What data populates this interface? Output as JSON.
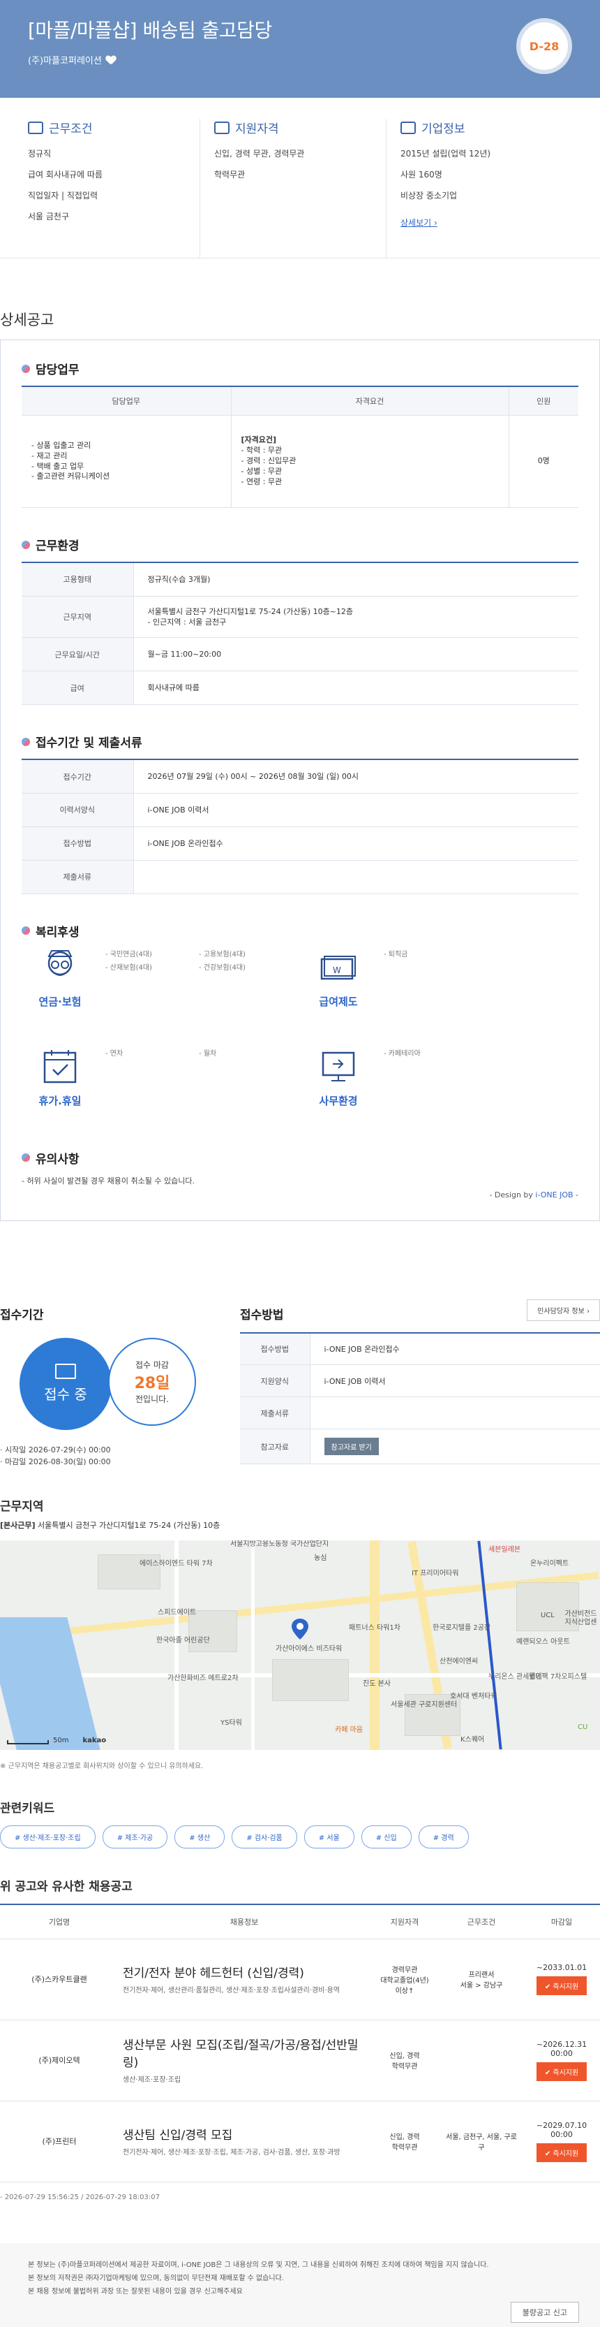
{
  "header": {
    "title": "[마플/마플샵] 배송팀 출고담당",
    "company": "(주)마플코퍼레이션",
    "dday": "D-28"
  },
  "summary": {
    "work_title": "근무조건",
    "work_lines": [
      "정규직",
      "급여 회사내규에 따름",
      "직업일자 | 직접입력",
      "서울 금천구"
    ],
    "qual_title": "지원자격",
    "qual_lines": [
      "신입, 경력 무관, 경력무관",
      "학력무관"
    ],
    "corp_title": "기업정보",
    "corp_lines": [
      "2015년 설립(업력 12년)",
      "사원 160명",
      "비상장 중소기업"
    ],
    "corp_more": "상세보기 ›"
  },
  "detail": {
    "section_title": "상세공고",
    "duty_title": "담당업무",
    "duty_headers": [
      "담당업무",
      "자격요건",
      "인원"
    ],
    "duty_tasks": [
      "- 상품 입출고 관리",
      "- 재고 관리",
      "- 택배 출고 업무",
      "- 출고관련 커뮤니케이션"
    ],
    "duty_reqs_head": "[자격요건]",
    "duty_reqs": [
      "- 학력 : 무관",
      "- 경력 : 신입무관",
      "- 성별 : 무관",
      "- 연령 : 무관"
    ],
    "duty_count": "0명",
    "env_title": "근무환경",
    "env_rows": [
      {
        "th": "고용형태",
        "td": "정규직(수습 3개월)"
      },
      {
        "th": "근무지역",
        "td": "서울특별시 금천구 가산디지털1로 75-24 (가산동) 10층~12층",
        "td2": "- 인근지역 : 서울 금천구"
      },
      {
        "th": "근무요일/시간",
        "td": "월~금 11:00~20:00"
      },
      {
        "th": "급여",
        "td": "회사내규에 따름"
      }
    ],
    "apply_title": "접수기간 및 제출서류",
    "apply_rows": [
      {
        "th": "접수기간",
        "td": "2026년 07월 29일 (수) 00시 ~ 2026년 08월 30일 (일) 00시"
      },
      {
        "th": "이력서양식",
        "td": "i-ONE JOB 이력서"
      },
      {
        "th": "접수방법",
        "td": "i-ONE JOB 온라인접수"
      },
      {
        "th": "제출서류",
        "td": ""
      }
    ],
    "welfare_title": "복리후생",
    "welfare": [
      {
        "label": "연금·보험",
        "items": [
          "- 국민연금(4대)",
          "- 고용보험(4대)",
          "- 산재보험(4대)",
          "- 건강보험(4대)"
        ],
        "icon": "pension-icon"
      },
      {
        "label": "급여제도",
        "items": [
          "- 퇴직금"
        ],
        "icon": "salary-icon"
      },
      {
        "label": "휴가.휴일",
        "items": [
          "- 연차",
          "- 월차"
        ],
        "icon": "calendar-icon"
      },
      {
        "label": "사무환경",
        "items": [
          "- 카페테리아"
        ],
        "icon": "monitor-icon"
      }
    ],
    "notice_title": "유의사항",
    "notice_text": "- 허위 사실이 발견될 경우 채용이 취소될 수 있습니다.",
    "design_by_prefix": "- Design by ",
    "design_by_brand": "i-ONE JOB",
    "design_by_suffix": " -"
  },
  "receipt": {
    "title": "접수기간",
    "status": "접수 중",
    "deadline_prefix": "접수 마감",
    "days_left": "28일",
    "deadline_suffix": "전입니다.",
    "start": "· 시작일 2026-07-29(수) 00:00",
    "end": "· 마감일 2026-08-30(일) 00:00"
  },
  "method": {
    "title": "접수방법",
    "hr_button": "인사담당자 정보 ›",
    "rows": [
      {
        "th": "접수방법",
        "td": "i-ONE JOB 온라인접수"
      },
      {
        "th": "지원양식",
        "td": "i-ONE JOB 이력서"
      },
      {
        "th": "제출서류",
        "td": ""
      },
      {
        "th": "참고자료",
        "td": ""
      }
    ],
    "doc_button": "참고자료 받기"
  },
  "region": {
    "title": "근무지역",
    "addr_label": "[본사근무]",
    "addr": " 서울특별시 금천구 가산디지털1로 75-24 (가산동) 10층",
    "map_labels": [
      "서울지방고용노동청\n국가산업단지",
      "에이스하이엔드\n타워 7차",
      "농심",
      "IT\n프리미어타워",
      "세븐일레븐",
      "온누리이펙트",
      "스피드에이트",
      "한국아졸\n어린공단",
      "가산아이에스\n비즈타워",
      "패트너스\n타워1차",
      "한국로지텔플\n2공장",
      "UCL",
      "가산비전드\n지식산업센",
      "예랜되오스\n아웃트",
      "가산한화비즈\n메트로2차",
      "진도\n본사",
      "산천에이엔씨",
      "누리온스\n관세법인",
      "서울세관\n구로지원센터",
      "호서대\n벤처타워",
      "롯데팩\n7차오피스텔",
      "YS타워",
      "카페 마음",
      "K스퀘어",
      "CU"
    ],
    "scale": "50m",
    "kakao": "kakao",
    "note": "※ 근무지역은 채용공고별로 회사위치와 상이할 수 있으니 유의하세요."
  },
  "keywords": {
    "title": "관련키워드",
    "items": [
      "# 생산·제조·포장·조립",
      "# 제조·가공",
      "# 생산",
      "# 검사·검품",
      "# 서울",
      "# 신입",
      "# 경력"
    ]
  },
  "similar": {
    "title": "위 공고와 유사한 채용공고",
    "headers": [
      "기업명",
      "채용정보",
      "지원자격",
      "근무조건",
      "마감일"
    ],
    "rows": [
      {
        "company": "(주)스카우트클랜",
        "title": "전기/전자 분야 헤드헌터 (신입/경력)",
        "sub": "전기전자·제어, 생산관리·품질관리, 생산·제조·포장·조립사설관리·경비·용역",
        "qual": "경력무관\n대학교졸업(4년)\n이상↑",
        "cond": "프리랜서\n서울 > 강남구",
        "deadline": "~2033.01.01",
        "apply": "✔ 즉시지원"
      },
      {
        "company": "(주)제이오텍",
        "title": "생산부문 사원 모집(조립/절곡/가공/용접/선반밀링)",
        "sub": "생산·제조·포장·조립",
        "qual": "신입, 경력\n학력무관",
        "cond": "",
        "deadline": "~2026.12.31 00:00",
        "apply": "✔ 즉시지원"
      },
      {
        "company": "(주)프린터",
        "title": "생산팀 신입/경력 모집",
        "sub": "전기전자·제어, 생산·제조·포장·조립, 제조·가공, 검사·검품, 생산, 포장·과방",
        "qual": "신입, 경력\n학력무관",
        "cond": "서울, 금천구, 서울, 구로구",
        "deadline": "~2029.07.10 00:00",
        "apply": "✔ 즉시지원"
      }
    ],
    "meta": "- 2026-07-29 15:56:25 / 2026-07-29 18:03:07"
  },
  "footer": {
    "lines": [
      "본 정보는 (주)마플코퍼레이션에서 제공한 자료이며, i-ONE JOB은 그 내용상의 오류 및 지연, 그 내용을 신뢰하여 취해진 조치에 대하여 책임을 지지 않습니다.",
      "본 정보의 저작권은 ㈜자기업마케팅에 있으며, 동의없이 무단전재 재배포할 수 없습니다.",
      "본 채용 정보에 불법허위 과장 또는 잘못된 내용이 있을 경우 신고해주세요"
    ],
    "report_button": "불량공고 신고"
  },
  "colors": {
    "brand": "#6a8fc0",
    "accent": "#2e66c8",
    "orange": "#f0772d"
  }
}
